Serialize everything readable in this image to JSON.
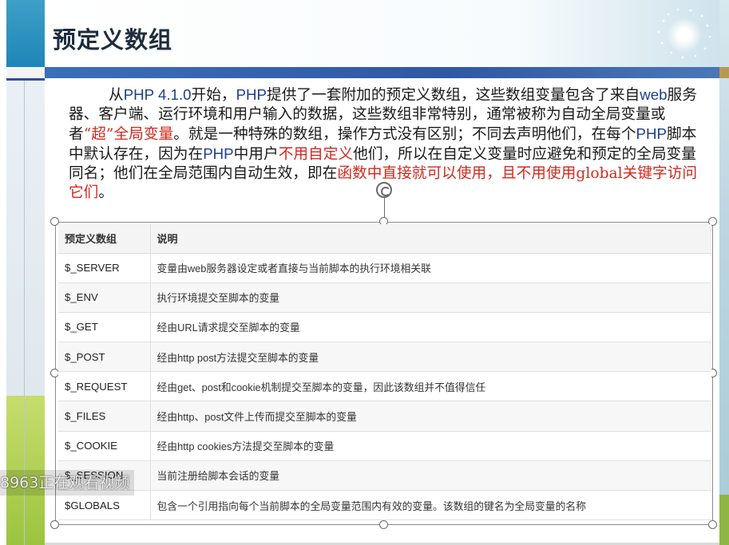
{
  "slide": {
    "title": "预定义数组",
    "intro": [
      {
        "text": "从",
        "style": "normal"
      },
      {
        "text": "PHP 4.1.0",
        "style": "blue"
      },
      {
        "text": "开始，",
        "style": "normal"
      },
      {
        "text": "PHP",
        "style": "blue"
      },
      {
        "text": "提供了一套附加的预定义数组，这些数组变量包含了来自",
        "style": "normal"
      },
      {
        "text": "web",
        "style": "blue"
      },
      {
        "text": "服务器、客户端、运行环境和用户输入的数据，这些数组非常特别，通常被称为自动全局变量或者",
        "style": "normal"
      },
      {
        "text": "“超”全局变量",
        "style": "red"
      },
      {
        "text": "。就是一种特殊的数组，操作方式没有区别；不同去声明他们，在每个",
        "style": "normal"
      },
      {
        "text": "PHP",
        "style": "blue"
      },
      {
        "text": "脚本中默认存在，因为在",
        "style": "normal"
      },
      {
        "text": "PHP",
        "style": "blue"
      },
      {
        "text": "中用户",
        "style": "normal"
      },
      {
        "text": "不用自定义",
        "style": "red"
      },
      {
        "text": "他们，所以在自定义变量时应避免和预定的全局变量同名；他们在全局范围内自动生效，即在",
        "style": "normal"
      },
      {
        "text": "函数中直接就可以使用，且不用使用",
        "style": "red"
      },
      {
        "text": "global",
        "style": "red"
      },
      {
        "text": "关键字访问它们",
        "style": "red"
      },
      {
        "text": "。",
        "style": "normal"
      }
    ]
  },
  "table": {
    "headers": [
      "预定义数组",
      "说明"
    ],
    "rows": [
      {
        "name": "$_SERVER",
        "desc": "变量由web服务器设定或者直接与当前脚本的执行环境相关联"
      },
      {
        "name": "$_ENV",
        "desc": "执行环境提交至脚本的变量"
      },
      {
        "name": "$_GET",
        "desc": "经由URL请求提交至脚本的变量"
      },
      {
        "name": "$_POST",
        "desc": "经由http post方法提交至脚本的变量"
      },
      {
        "name": "$_REQUEST",
        "desc": "经由get、post和cookie机制提交至脚本的变量，因此该数组并不值得信任"
      },
      {
        "name": "$_FILES",
        "desc": "经由http、post文件上传而提交至脚本的变量"
      },
      {
        "name": "$_COOKIE",
        "desc": "经由http cookies方法提交至脚本的变量"
      },
      {
        "name": "$_SESSION",
        "desc": "当前注册给脚本会话的变量"
      },
      {
        "name": "$GLOBALS",
        "desc": "包含一个引用指向每个当前脚本的全局变量范围内有效的变量。该数组的键名为全局变量的名称"
      }
    ]
  },
  "overlay": {
    "text": "8963正在观看视频"
  },
  "colors": {
    "title_bar": "#2f58a3",
    "highlight_red": "#d2291e",
    "highlight_blue": "#1d3f8f",
    "accent_green": "#9cc43f"
  }
}
